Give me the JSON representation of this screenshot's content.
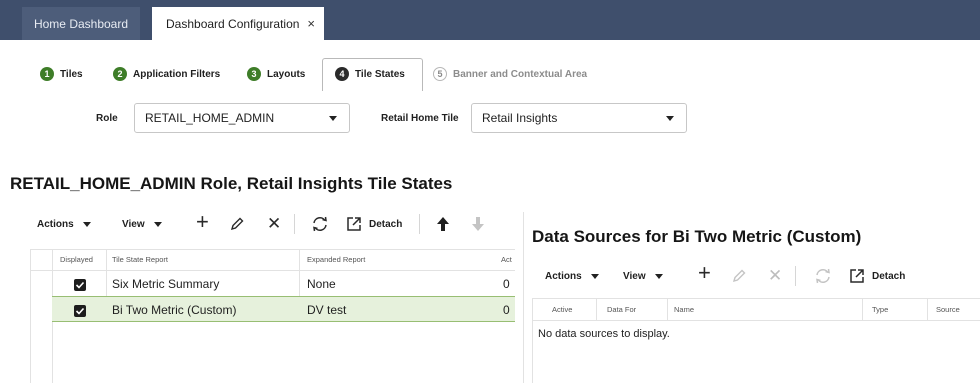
{
  "tabs": {
    "home": "Home Dashboard",
    "config": "Dashboard Configuration",
    "close": "×"
  },
  "steps": [
    {
      "num": "1",
      "label": "Tiles"
    },
    {
      "num": "2",
      "label": "Application Filters"
    },
    {
      "num": "3",
      "label": "Layouts"
    },
    {
      "num": "4",
      "label": "Tile States"
    },
    {
      "num": "5",
      "label": "Banner and Contextual Area"
    }
  ],
  "filters": {
    "role_label": "Role",
    "role_value": "RETAIL_HOME_ADMIN",
    "tile_label": "Retail Home Tile",
    "tile_value": "Retail Insights"
  },
  "page_title": "RETAIL_HOME_ADMIN Role, Retail Insights Tile States",
  "left_toolbar": {
    "actions": "Actions",
    "view": "View",
    "detach": "Detach"
  },
  "left_table": {
    "headers": [
      "Displayed",
      "Tile State Report",
      "Expanded Report",
      "Act"
    ],
    "rows": [
      {
        "report": "Six Metric Summary",
        "expanded": "None",
        "act": "0"
      },
      {
        "report": "Bi Two Metric (Custom)",
        "expanded": "DV test",
        "act": "0"
      }
    ]
  },
  "right_panel": {
    "title": "Data Sources for Bi Two Metric (Custom)",
    "actions": "Actions",
    "view": "View",
    "detach": "Detach",
    "headers": [
      "Active",
      "Data For",
      "Name",
      "Type",
      "Source"
    ],
    "empty": "No data sources to display."
  },
  "colors": {
    "tabbar": "#3f4f6c",
    "step_green": "#3e7d28",
    "selected_row": "#e6f1dc"
  }
}
